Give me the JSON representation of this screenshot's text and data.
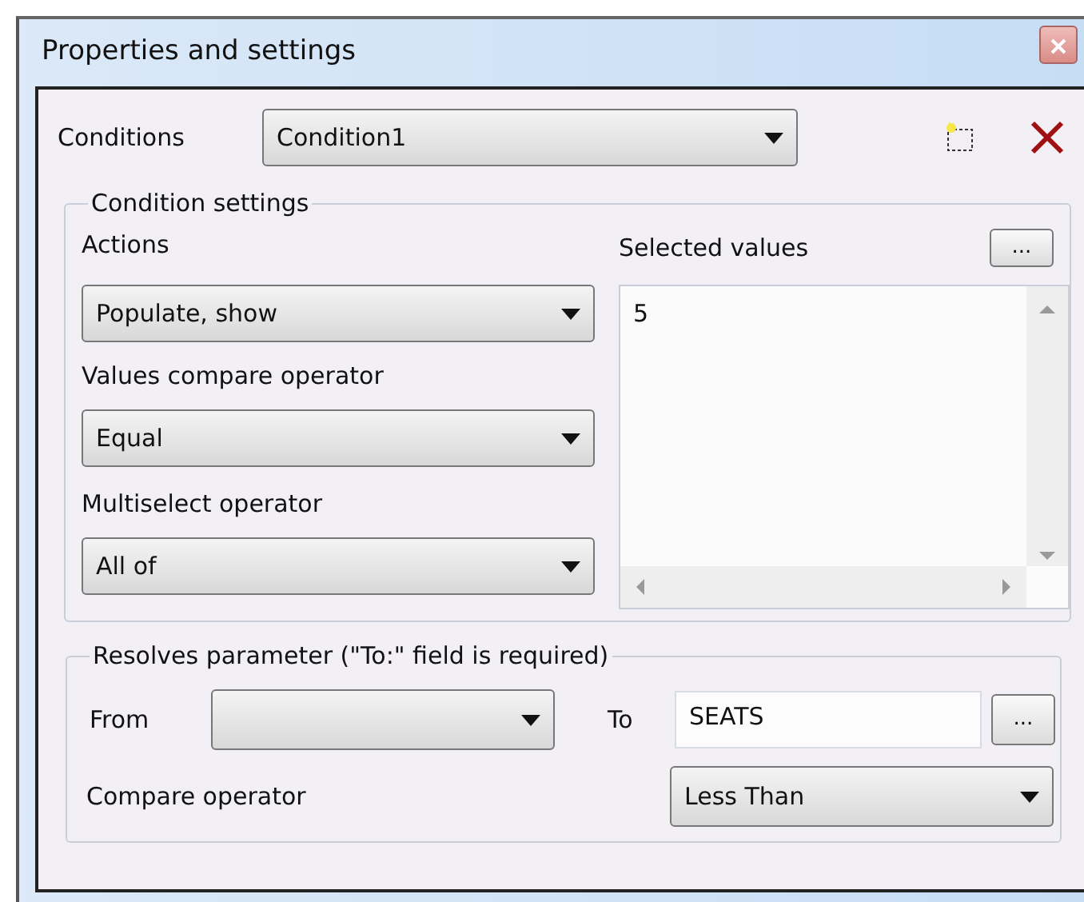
{
  "window": {
    "title": "Properties and settings"
  },
  "conditions": {
    "label": "Conditions",
    "value": "Condition1"
  },
  "condition_settings": {
    "legend": "Condition settings",
    "actions": {
      "label": "Actions",
      "value": "Populate, show"
    },
    "values_compare_operator": {
      "label": "Values compare operator",
      "value": "Equal"
    },
    "multiselect_operator": {
      "label": "Multiselect operator",
      "value": "All of"
    },
    "selected_values": {
      "label": "Selected values",
      "button": "...",
      "items": [
        "5"
      ]
    }
  },
  "resolves_parameter": {
    "legend": "Resolves parameter (\"To:\" field is required)",
    "from": {
      "label": "From"
    },
    "to": {
      "label": "To",
      "value": "SEATS",
      "button": "..."
    },
    "compare_operator": {
      "label": "Compare operator",
      "value": "Less Than"
    }
  }
}
